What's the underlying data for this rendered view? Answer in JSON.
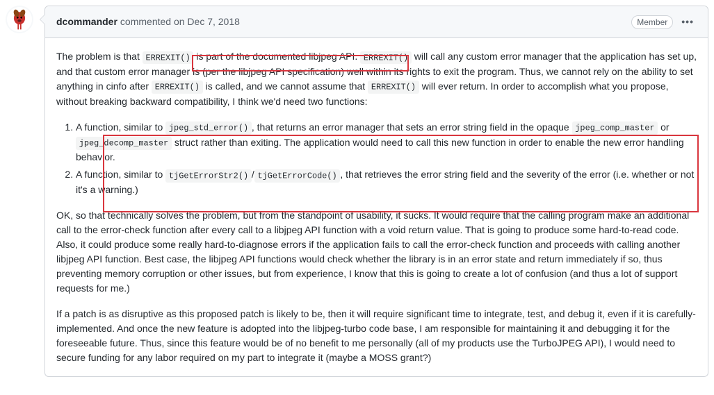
{
  "comment": {
    "author": "dcommander",
    "action": "commented on Dec 7, 2018",
    "badge": "Member",
    "body": {
      "p1_a": "The problem is that ",
      "p1_code1": "ERREXIT()",
      "p1_b": " is part of the documented libjpeg API. ",
      "p1_code2": "ERREXIT()",
      "p1_c": " will call any custom error manager that the application has set up, and that custom error manager is (per the libjpeg API specification) well within its rights to exit the program. Thus, we cannot rely on the ability to set anything in cinfo after ",
      "p1_code3": "ERREXIT()",
      "p1_d": " is called, and we cannot assume that ",
      "p1_code4": "ERREXIT()",
      "p1_e": " will ever return. In order to accomplish what you propose, without breaking backward compatibility, I think we'd need two functions:",
      "li1_a": "A function, similar to ",
      "li1_code1": "jpeg_std_error()",
      "li1_b": ", that returns an error manager that sets an error string field in the opaque ",
      "li1_code2": "jpeg_comp_master",
      "li1_c": " or ",
      "li1_code3": "jpeg_decomp_master",
      "li1_d": " struct rather than exiting. The application would need to call this new function in order to enable the new error handling behavior.",
      "li2_a": "A function, similar to ",
      "li2_code1": "tjGetErrorStr2()",
      "li2_b": "/",
      "li2_code2": "tjGetErrorCode()",
      "li2_c": ", that retrieves the error string field and the severity of the error (i.e. whether or not it's a warning.)",
      "p2": "OK, so that technically solves the problem, but from the standpoint of usability, it sucks. It would require that the calling program make an additional call to the error-check function after every call to a libjpeg API function with a void return value. That is going to produce some hard-to-read code. Also, it could produce some really hard-to-diagnose errors if the application fails to call the error-check function and proceeds with calling another libjpeg API function. Best case, the libjpeg API functions would check whether the library is in an error state and return immediately if so, thus preventing memory corruption or other issues, but from experience, I know that this is going to create a lot of confusion (and thus a lot of support requests for me.)",
      "p3": "If a patch is as disruptive as this proposed patch is likely to be, then it will require significant time to integrate, test, and debug it, even if it is carefully-implemented. And once the new feature is adopted into the libjpeg-turbo code base, I am responsible for maintaining it and debugging it for the foreseeable future. Thus, since this feature would be of no benefit to me personally (all of my products use the TurboJPEG API), I would need to secure funding for any labor required on my part to integrate it (maybe a MOSS grant?)"
    }
  }
}
